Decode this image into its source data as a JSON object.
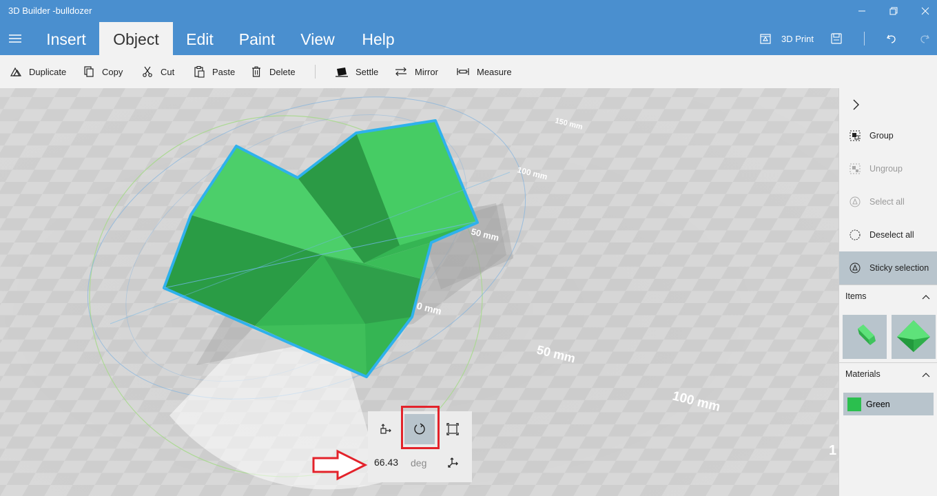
{
  "window": {
    "title": "3D Builder -bulldozer",
    "controls": [
      "minimize-icon",
      "restore-icon",
      "close-icon"
    ]
  },
  "menu": {
    "tabs": [
      {
        "label": "Insert",
        "active": false
      },
      {
        "label": "Object",
        "active": true
      },
      {
        "label": "Edit",
        "active": false
      },
      {
        "label": "Paint",
        "active": false
      },
      {
        "label": "View",
        "active": false
      },
      {
        "label": "Help",
        "active": false
      }
    ],
    "print_label": "3D Print"
  },
  "toolbar": {
    "duplicate": "Duplicate",
    "copy": "Copy",
    "cut": "Cut",
    "paste": "Paste",
    "delete": "Delete",
    "settle": "Settle",
    "mirror": "Mirror",
    "measure": "Measure"
  },
  "viewport": {
    "scale_labels": [
      "150 mm",
      "100 mm",
      "50 mm",
      "0 mm",
      "50 mm",
      "100 mm",
      "1"
    ],
    "object_color": "#3ec95a",
    "selection_color": "#2fb1ec"
  },
  "right_panel": {
    "group": "Group",
    "ungroup": "Ungroup",
    "select_all": "Select all",
    "deselect_all": "Deselect all",
    "sticky_selection": "Sticky selection",
    "items_header": "Items",
    "materials_header": "Materials",
    "material_name": "Green",
    "material_color": "#2bbf4e"
  },
  "rotation_widget": {
    "value": "66.43",
    "unit": "deg",
    "active_tool": "rotate"
  },
  "annotations": {
    "highlight_color": "#e3222a"
  }
}
